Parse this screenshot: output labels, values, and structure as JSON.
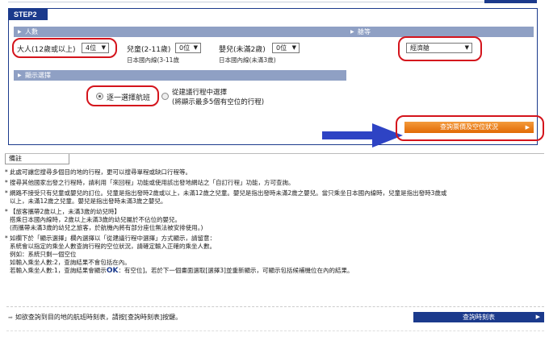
{
  "step": {
    "label": "STEP2"
  },
  "passengers": {
    "header": "人數",
    "adult": {
      "label": "大人(12歲或以上)",
      "value": "4位"
    },
    "child": {
      "label": "兒童(2-11歲)",
      "value": "0位",
      "sub": "日本國內線(3-11歲"
    },
    "infant": {
      "label": "嬰兒(未滿2歲)",
      "value": "0位",
      "sub": "日本國內線(未滿3歲)"
    }
  },
  "cabin": {
    "header": "艙等",
    "value": "經濟艙"
  },
  "display": {
    "header": "顯示選擇",
    "option1": "逐一選擇航班",
    "option2_line1": "從建議行程中選擇",
    "option2_line2": "(將顯示最多5個有空位的行程)"
  },
  "search_button": {
    "label": "查詢票價及空位狀況"
  },
  "notes": {
    "tab": "備註",
    "lines": [
      "此處可讓您搜尋多個目的地的行程，更可以搜尋單程或缺口行程等。",
      "搜尋其他國家出發之行程時，請利用「來回程」功能或使用該出發地網站之「自訂行程」功能，方可查詢。",
      "網路不接受只有兒童或嬰兒的訂位。兒童是指出發時2歲或以上，未滿12歲之兒童。嬰兒是指出發時未滿2歲之嬰兒。當只乘坐日本國內線時，兒童是指出發時3歲或",
      "以上，未滿12歲之兒童。嬰兒是指出發時未滿3歲之嬰兒。",
      "【旅客攜帶2歲以上，未滿3歲的幼兒時】",
      "搭乘日本國內線時，2歲以上未滿3歲的幼兒屬於不佔位的嬰兒。",
      "(而攜帶未滿3歲的幼兒之旅客，於航機內將有部分座位無法被安排使用。)",
      "如欄下於「顯示選擇」欄內選擇以「從建議行程中選擇」方式顯示，請留意：",
      "系統會以指定的乘坐人數查詢行程的空位狀況，請確定輸入正確的乘坐人數。",
      "例如：系統只剩一個空位",
      "如輸入乘坐人數:2，查詢結果不會包括在內。",
      "若輸入乘坐人數:1，查詢結果會顯示",
      "：有空位]。若於下一個畫面選取[選擇3]並重新顯示，可顯示包括候補機位在內的結果。"
    ],
    "ok_mark": "OK"
  },
  "timetable": {
    "text": "如欲查詢到目的地的航班時刻表，請按[查詢時刻表]按鍵。",
    "button": "查詢時刻表"
  },
  "colors": {
    "brand": "#1b3a8c",
    "accent": "#e26a05",
    "highlight": "#d4141c"
  }
}
